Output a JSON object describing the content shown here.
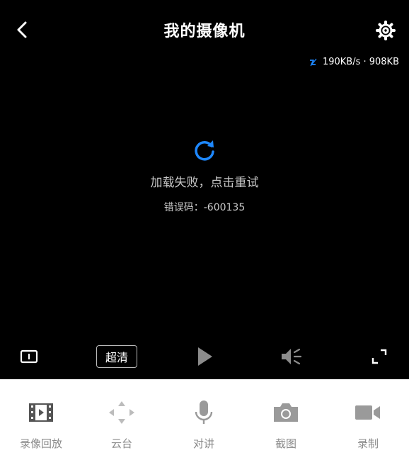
{
  "header": {
    "title": "我的摄像机"
  },
  "stats": {
    "speed": "190KB/s · 908KB"
  },
  "player": {
    "error_message": "加载失败，点击重试",
    "error_code": "错误码：-600135",
    "quality_label": "超清"
  },
  "toolbar": [
    {
      "label": "录像回放",
      "icon": "playback-film-icon"
    },
    {
      "label": "云台",
      "icon": "ptz-direction-icon"
    },
    {
      "label": "对讲",
      "icon": "microphone-icon"
    },
    {
      "label": "截图",
      "icon": "camera-icon"
    },
    {
      "label": "录制",
      "icon": "video-camera-icon"
    }
  ],
  "colors": {
    "accent": "#1e88ff",
    "toolbar_icon": "#9a9a9a",
    "toolbar_label": "#8a8a8a"
  }
}
